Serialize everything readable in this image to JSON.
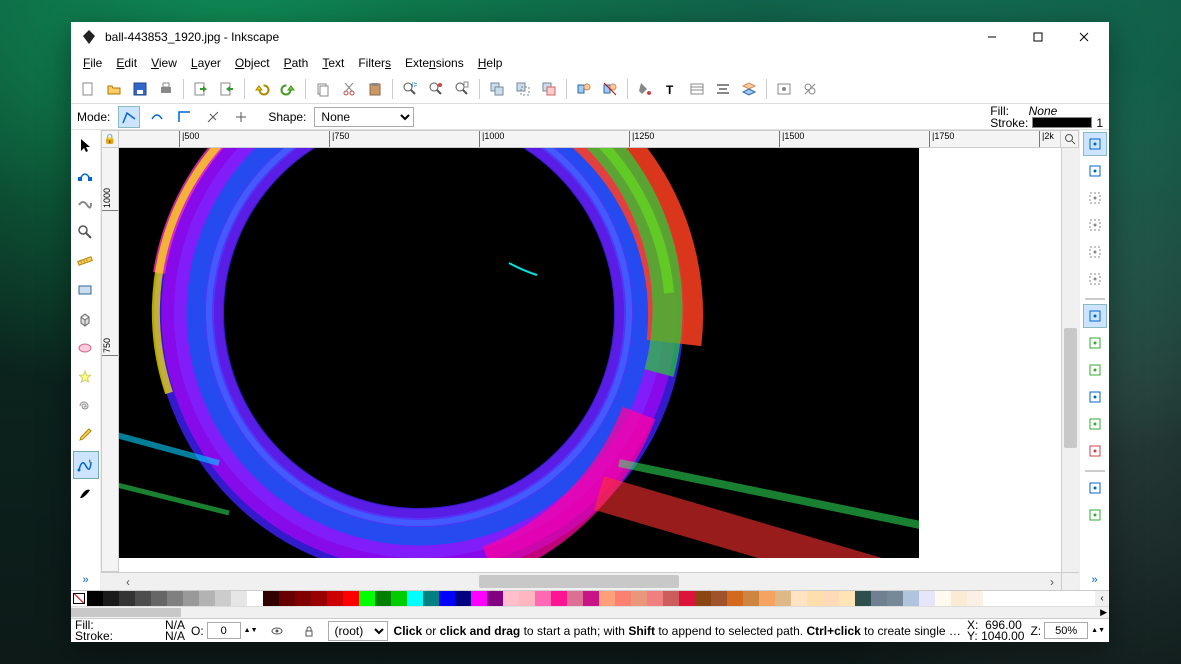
{
  "window": {
    "title": "ball-443853_1920.jpg - Inkscape",
    "minimize": "—",
    "maximize": "☐",
    "close": "✕"
  },
  "menubar": [
    {
      "label": "File",
      "u": "F"
    },
    {
      "label": "Edit",
      "u": "E"
    },
    {
      "label": "View",
      "u": "V"
    },
    {
      "label": "Layer",
      "u": "L"
    },
    {
      "label": "Object",
      "u": "O"
    },
    {
      "label": "Path",
      "u": "P"
    },
    {
      "label": "Text",
      "u": "T"
    },
    {
      "label": "Filters",
      "u": "s"
    },
    {
      "label": "Extensions",
      "u": "n"
    },
    {
      "label": "Help",
      "u": "H"
    }
  ],
  "toolbar": [
    {
      "name": "new-icon"
    },
    {
      "name": "open-icon"
    },
    {
      "name": "save-icon"
    },
    {
      "name": "print-icon"
    },
    {
      "sep": true
    },
    {
      "name": "import-icon"
    },
    {
      "name": "export-icon"
    },
    {
      "sep": true
    },
    {
      "name": "undo-icon"
    },
    {
      "name": "redo-icon"
    },
    {
      "sep": true
    },
    {
      "name": "copy-icon"
    },
    {
      "name": "cut-icon"
    },
    {
      "name": "paste-icon"
    },
    {
      "sep": true
    },
    {
      "name": "zoom-selection-icon"
    },
    {
      "name": "zoom-drawing-icon"
    },
    {
      "name": "zoom-page-icon"
    },
    {
      "sep": true
    },
    {
      "name": "duplicate-icon"
    },
    {
      "name": "clone-icon"
    },
    {
      "name": "unlink-clone-icon"
    },
    {
      "sep": true
    },
    {
      "name": "group-icon"
    },
    {
      "name": "ungroup-icon"
    },
    {
      "sep": true
    },
    {
      "name": "fill-stroke-icon"
    },
    {
      "name": "text-icon"
    },
    {
      "name": "xml-icon"
    },
    {
      "name": "align-icon"
    },
    {
      "name": "layers-icon"
    },
    {
      "sep": true
    },
    {
      "name": "preferences-icon"
    },
    {
      "name": "document-properties-icon"
    }
  ],
  "tool_options": {
    "mode_label": "Mode:",
    "shape_label": "Shape:",
    "shape_value": "None",
    "fill_label": "Fill:",
    "fill_value": "None",
    "stroke_label": "Stroke:",
    "stroke_opacity": "1"
  },
  "toolbox": [
    "selector-tool",
    "node-tool",
    "tweak-tool",
    "zoom-tool",
    "measure-tool",
    "rectangle-tool",
    "3dbox-tool",
    "ellipse-tool",
    "star-tool",
    "spiral-tool",
    "pencil-tool",
    "bezier-tool",
    "calligraphy-tool"
  ],
  "active_tool": "bezier-tool",
  "ruler_h": [
    "500",
    "750",
    "1000",
    "1250",
    "1500",
    "1750",
    "2k"
  ],
  "ruler_v": [
    "1000",
    "750"
  ],
  "snapbar": [
    "snap-enable",
    "snap-bbox",
    "snap-bbox-edge",
    "snap-bbox-corner",
    "snap-bbox-midpoint",
    "snap-bbox-center",
    "sep",
    "snap-node",
    "snap-path",
    "snap-intersection",
    "snap-cusp",
    "snap-smooth",
    "snap-line-midpoint",
    "sep",
    "snap-object-center",
    "snap-rotation-center"
  ],
  "palette": [
    "#000000",
    "#1a1a1a",
    "#333333",
    "#4d4d4d",
    "#666666",
    "#808080",
    "#999999",
    "#b3b3b3",
    "#cccccc",
    "#e6e6e6",
    "#ffffff",
    "#330000",
    "#660000",
    "#800000",
    "#990000",
    "#cc0000",
    "#ff0000",
    "#00ff00",
    "#008000",
    "#00cc00",
    "#00ffff",
    "#008080",
    "#0000ff",
    "#000080",
    "#ff00ff",
    "#800080",
    "#ffc0cb",
    "#ffb6c1",
    "#ff69b4",
    "#ff1493",
    "#db7093",
    "#c71585",
    "#ffa07a",
    "#fa8072",
    "#e9967a",
    "#f08080",
    "#cd5c5c",
    "#dc143c",
    "#8b4513",
    "#a0522d",
    "#d2691e",
    "#cd853f",
    "#f4a460",
    "#deb887",
    "#ffe4c4",
    "#ffdead",
    "#ffdab9",
    "#ffe4b5",
    "#2f4f4f",
    "#708090",
    "#778899",
    "#b0c4de",
    "#e6e6fa",
    "#fffaf0",
    "#faebd7",
    "#faf0e6"
  ],
  "statusbar": {
    "fill_label": "Fill:",
    "fill_value": "N/A",
    "stroke_label": "Stroke:",
    "stroke_value": "N/A",
    "opacity_label": "O:",
    "opacity_value": "0",
    "layer_value": "(root)",
    "hint": "Click or click and drag to start a path; with Shift to append to selected path. Ctrl+click to create single dots (...",
    "x_label": "X:",
    "x_value": "696.00",
    "y_label": "Y:",
    "y_value": "1040.00",
    "z_label": "Z:",
    "z_value": "50%"
  }
}
